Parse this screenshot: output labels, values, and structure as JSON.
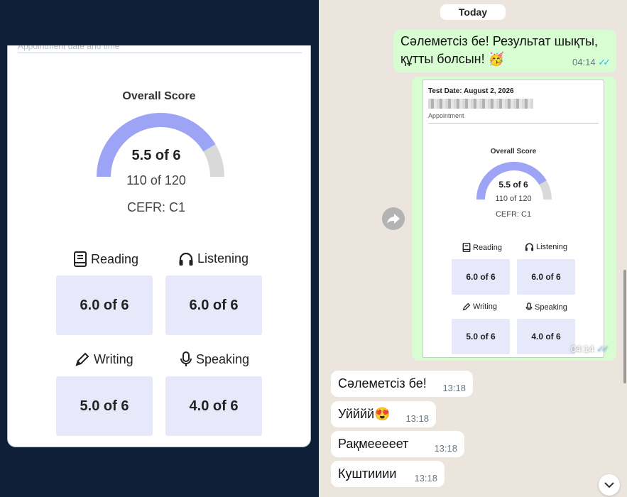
{
  "left": {
    "cropped_header": "Appointment date and time",
    "overall_title": "Overall Score",
    "score_main": "5.5 of 6",
    "score_sub": "110 of 120",
    "cefr": "CEFR: C1",
    "gauge_fill_fraction": 0.83,
    "gauge_color": "#9ea4f5",
    "gauge_track_color": "#d9d9d9",
    "skills": [
      {
        "label": "Reading",
        "icon": "book-icon",
        "score": "6.0 of 6"
      },
      {
        "label": "Listening",
        "icon": "headphones-icon",
        "score": "6.0 of 6"
      },
      {
        "label": "Writing",
        "icon": "pencil-icon",
        "score": "5.0 of 6"
      },
      {
        "label": "Speaking",
        "icon": "microphone-icon",
        "score": "4.0 of 6"
      }
    ]
  },
  "chat": {
    "date_label": "Today",
    "messages_out": [
      {
        "text": "Сәлеметсіз бе! Результат шықты, құтты болсын! 🥳",
        "time": "04:14"
      }
    ],
    "image_message": {
      "test_date": "Test Date: August 2, 2026",
      "appointment": "Appointment",
      "overall_title": "Overall Score",
      "score_main": "5.5 of 6",
      "score_sub": "110 of 120",
      "cefr": "CEFR: C1",
      "skills": [
        {
          "label": "Reading",
          "score": "6.0 of 6"
        },
        {
          "label": "Listening",
          "score": "6.0 of 6"
        },
        {
          "label": "Writing",
          "score": "5.0 of 6"
        },
        {
          "label": "Speaking",
          "score": "4.0 of 6"
        }
      ],
      "time": "04:14"
    },
    "messages_in": [
      {
        "text": "Сәлеметсіз бе!",
        "time": "13:18"
      },
      {
        "text": "Уйййй😍",
        "time": "13:18"
      },
      {
        "text": "Рақмееееет",
        "time": "13:18"
      },
      {
        "text": "Куштииии",
        "time": "13:18"
      }
    ]
  }
}
